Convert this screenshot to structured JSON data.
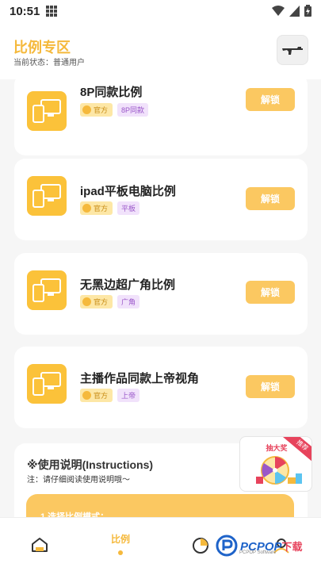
{
  "status_bar": {
    "time": "10:51"
  },
  "header": {
    "title": "比例专区",
    "subtitle": "当前状态：普通用户"
  },
  "cards": [
    {
      "name": "8P同款比例",
      "tag_official": "官方",
      "tag_category": "8P同款",
      "unlock_label": "解锁"
    },
    {
      "name": "ipad平板电脑比例",
      "tag_official": "官方",
      "tag_category": "平板",
      "unlock_label": "解锁"
    },
    {
      "name": "无黑边超广角比例",
      "tag_official": "官方",
      "tag_category": "广角",
      "unlock_label": "解锁"
    },
    {
      "name": "主播作品同款上帝视角",
      "tag_official": "官方",
      "tag_category": "上帝",
      "unlock_label": "解锁"
    }
  ],
  "instructions": {
    "heading": "※使用说明(Instructions)",
    "note": "注：请仔细阅读使用说明哦～",
    "step1": "1.选择比例模式："
  },
  "promo": {
    "badge": "推荐",
    "title": "抽大奖"
  },
  "tabbar": {
    "tabs": [
      {
        "label": "",
        "icon": "home-icon"
      },
      {
        "label": "比例",
        "icon": "ratio-icon"
      },
      {
        "label": "",
        "icon": "pie-chart-icon"
      },
      {
        "label": "",
        "icon": "profile-icon"
      }
    ]
  },
  "watermark": {
    "brand": "PCPOP",
    "suffix": "下载",
    "sub": "PCPOP Software"
  },
  "colors": {
    "accent": "#f5b93c",
    "button": "#fbc861",
    "icon_bg": "#fbc23a",
    "tag_purple": "#9a57c9"
  }
}
